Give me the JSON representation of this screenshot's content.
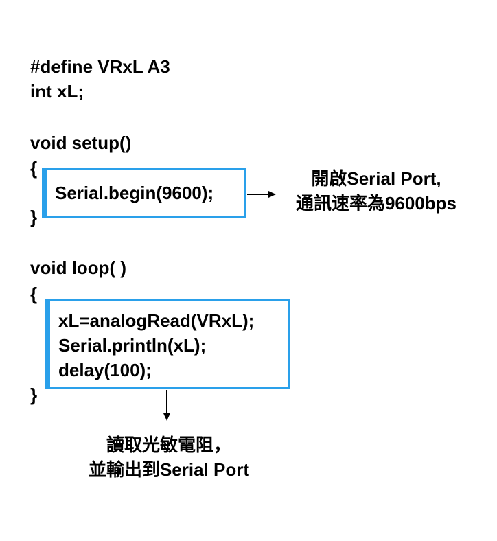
{
  "code": {
    "define_line": "#define VRxL A3",
    "int_line": "int xL;",
    "setup_sig": "void setup()",
    "setup_open": "{",
    "setup_body": "Serial.begin(9600);",
    "setup_close": "}",
    "loop_sig": "void loop( )",
    "loop_open": "{",
    "loop_body": [
      "xL=analogRead(VRxL);",
      "Serial.println(xL);",
      "delay(100);"
    ],
    "loop_close": "}"
  },
  "annotations": {
    "setup_note": [
      "開啟Serial Port,",
      "通訊速率為9600bps"
    ],
    "loop_note": [
      "讀取光敏電阻，",
      "並輸出到Serial Port"
    ]
  },
  "colors": {
    "box_border": "#2aa0ea",
    "text": "#000000",
    "background": "#ffffff"
  }
}
